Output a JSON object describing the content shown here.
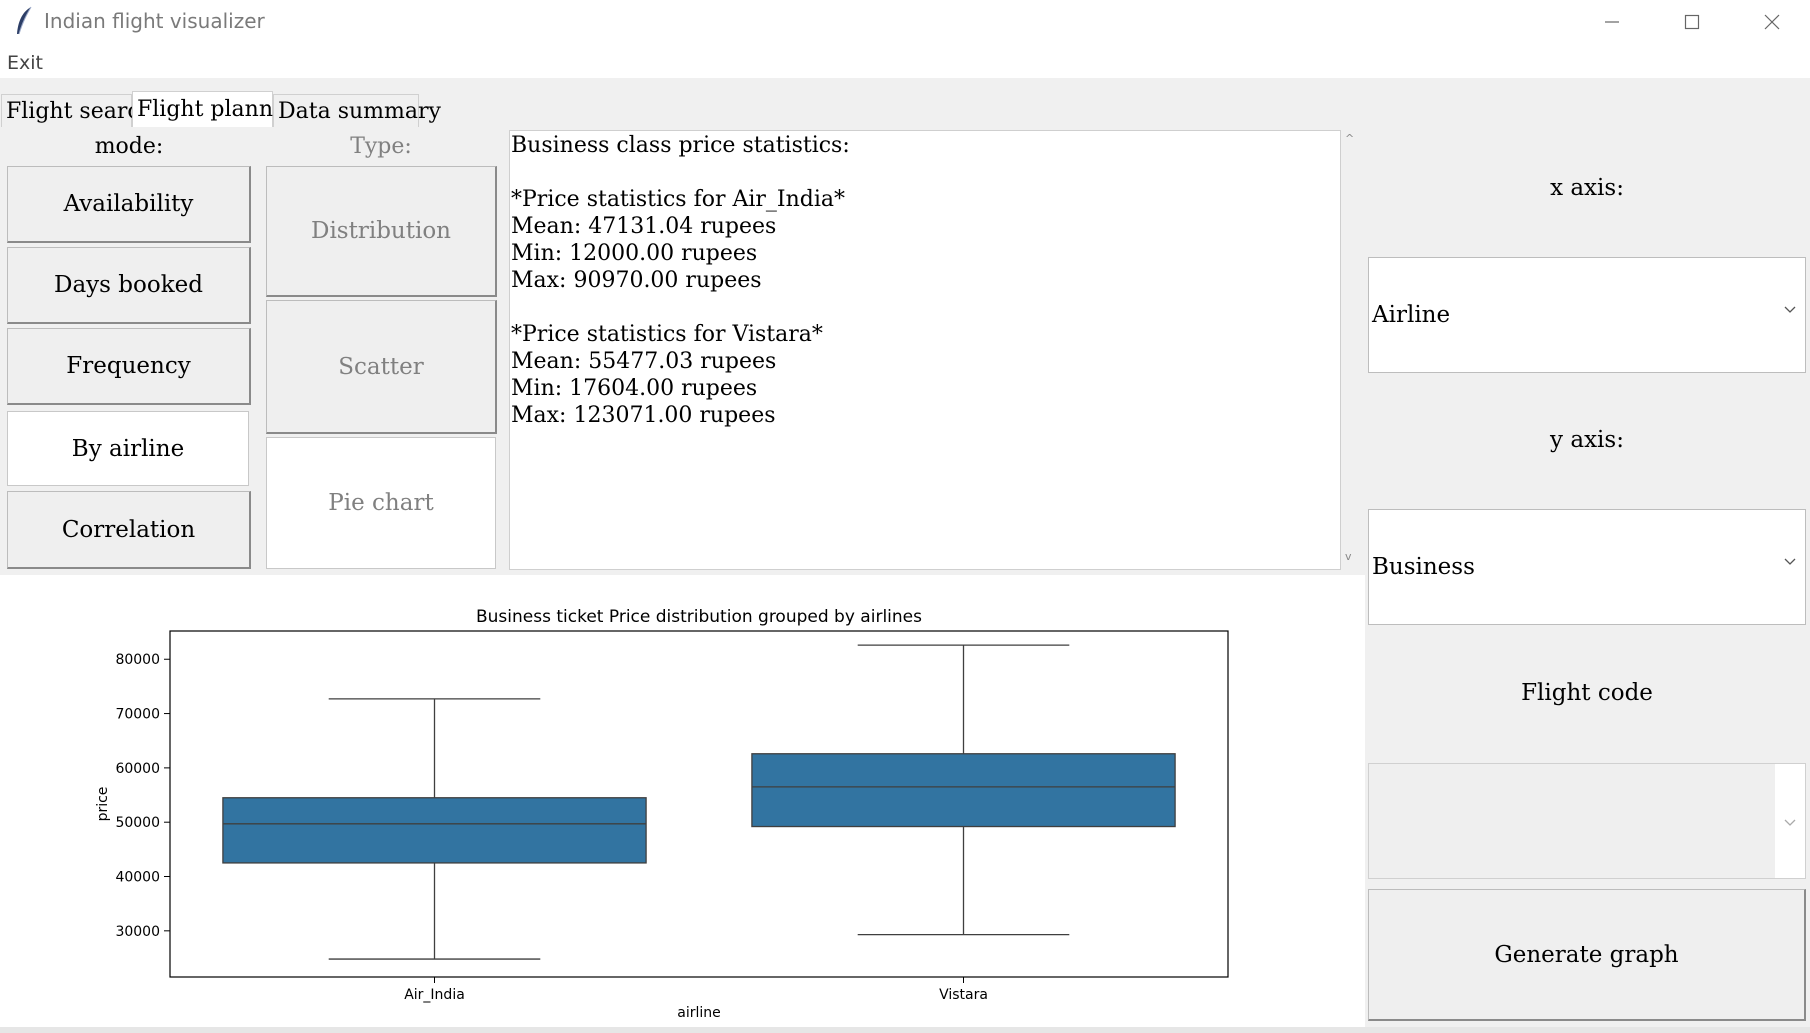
{
  "window": {
    "title": "Indian flight visualizer",
    "controls": [
      "—",
      "☐",
      "✕"
    ]
  },
  "menu": {
    "exit_label": "Exit"
  },
  "tabs": [
    {
      "label": "Flight search",
      "active": false
    },
    {
      "label": "Flight planner",
      "active": true
    },
    {
      "label": "Data summary",
      "active": false
    }
  ],
  "mode": {
    "label": "mode:",
    "buttons": [
      {
        "label": "Availability",
        "selected": false
      },
      {
        "label": "Days booked",
        "selected": false
      },
      {
        "label": "Frequency",
        "selected": false
      },
      {
        "label": "By airline",
        "selected": true
      },
      {
        "label": "Correlation",
        "selected": false
      }
    ]
  },
  "type": {
    "label": "Type:",
    "buttons": [
      {
        "label": "Distribution",
        "selected": false
      },
      {
        "label": "Scatter",
        "selected": false
      },
      {
        "label": "Pie chart",
        "selected": true
      }
    ]
  },
  "stats": {
    "text": "Business class price statistics:\n\n*Price statistics for Air_India*\nMean: 47131.04 rupees\nMin: 12000.00 rupees\nMax: 90970.00 rupees\n\n*Price statistics for Vistara*\nMean: 55477.03 rupees\nMin: 17604.00 rupees\nMax: 123071.00 rupees"
  },
  "right_panel": {
    "x_axis_label": "x axis:",
    "x_axis_value": "Airline",
    "y_axis_label": "y axis:",
    "y_axis_value": "Business",
    "flight_code_label": "Flight code",
    "flight_code_value": "",
    "generate_label": "Generate graph"
  },
  "colors": {
    "box_fill": "#3274a1",
    "window_bg": "#f0f0f0"
  },
  "chart_data": {
    "type": "box",
    "title": "Business ticket Price distribution grouped by airlines",
    "xlabel": "airline",
    "ylabel": "price",
    "categories": [
      "Air_India",
      "Vistara"
    ],
    "boxes": [
      {
        "name": "Air_India",
        "whisker_low": 24800,
        "q1": 42500,
        "median": 49700,
        "q3": 54500,
        "whisker_high": 72700
      },
      {
        "name": "Vistara",
        "whisker_low": 29300,
        "q1": 49200,
        "median": 56500,
        "q3": 62600,
        "whisker_high": 82600
      }
    ],
    "yticks": [
      30000,
      40000,
      50000,
      60000,
      70000,
      80000
    ],
    "ylim": [
      21500,
      85200
    ],
    "grid": false
  }
}
